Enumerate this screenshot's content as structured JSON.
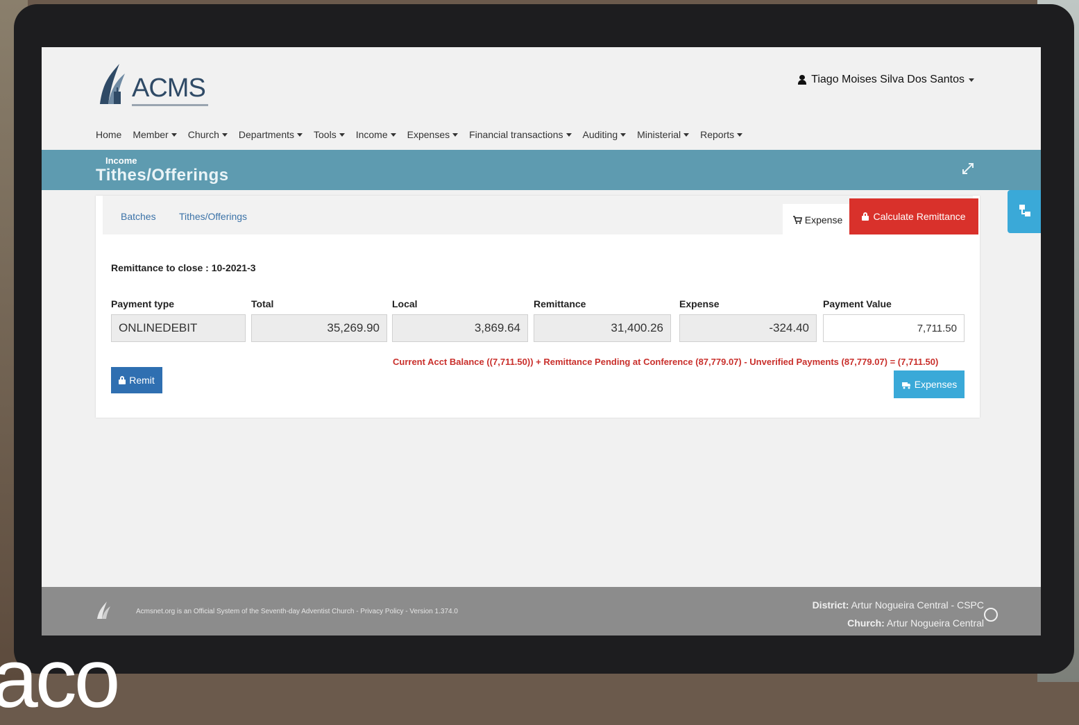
{
  "header": {
    "logo_text": "ACMS",
    "user_name": "Tiago Moises Silva Dos Santos"
  },
  "nav": [
    {
      "label": "Home",
      "dropdown": false
    },
    {
      "label": "Member",
      "dropdown": true
    },
    {
      "label": "Church",
      "dropdown": true
    },
    {
      "label": "Departments",
      "dropdown": true
    },
    {
      "label": "Tools",
      "dropdown": true
    },
    {
      "label": "Income",
      "dropdown": true
    },
    {
      "label": "Expenses",
      "dropdown": true
    },
    {
      "label": "Financial transactions",
      "dropdown": true
    },
    {
      "label": "Auditing",
      "dropdown": true
    },
    {
      "label": "Ministerial",
      "dropdown": true
    },
    {
      "label": "Reports",
      "dropdown": true
    }
  ],
  "page": {
    "section": "Income",
    "title": "Tithes/Offerings"
  },
  "tabs": {
    "batches": "Batches",
    "tithes": "Tithes/Offerings",
    "expense": "Expense",
    "calculate": "Calculate Remittance"
  },
  "remittance": {
    "title": "Remittance to close : 10-2021-3",
    "headers": {
      "payment_type": "Payment type",
      "total": "Total",
      "local": "Local",
      "remittance": "Remittance",
      "expense": "Expense",
      "payment_value": "Payment Value"
    },
    "row": {
      "payment_type": "ONLINEDEBIT",
      "total": "35,269.90",
      "local": "3,869.64",
      "remittance": "31,400.26",
      "expense": "-324.40",
      "payment_value": "7,711.50"
    },
    "remit_label": "Remit",
    "balance_line": "Current Acct Balance ((7,711.50)) + Remittance Pending at Conference (87,779.07) - Unverified Payments (87,779.07) = (7,711.50)",
    "expenses_label": "Expenses"
  },
  "footer": {
    "text": "Acmsnet.org is an Official System of the Seventh-day Adventist Church - Privacy Policy - Version 1.374.0",
    "district_label": "District:",
    "district_value": "Artur Nogueira Central - CSPC",
    "church_label": "Church:",
    "church_value": "Artur Nogueira Central"
  },
  "overlay": "aco",
  "colors": {
    "band": "#5e9bb0",
    "danger": "#d9312b",
    "primary": "#2f6fb1",
    "info": "#3aa9d8"
  }
}
